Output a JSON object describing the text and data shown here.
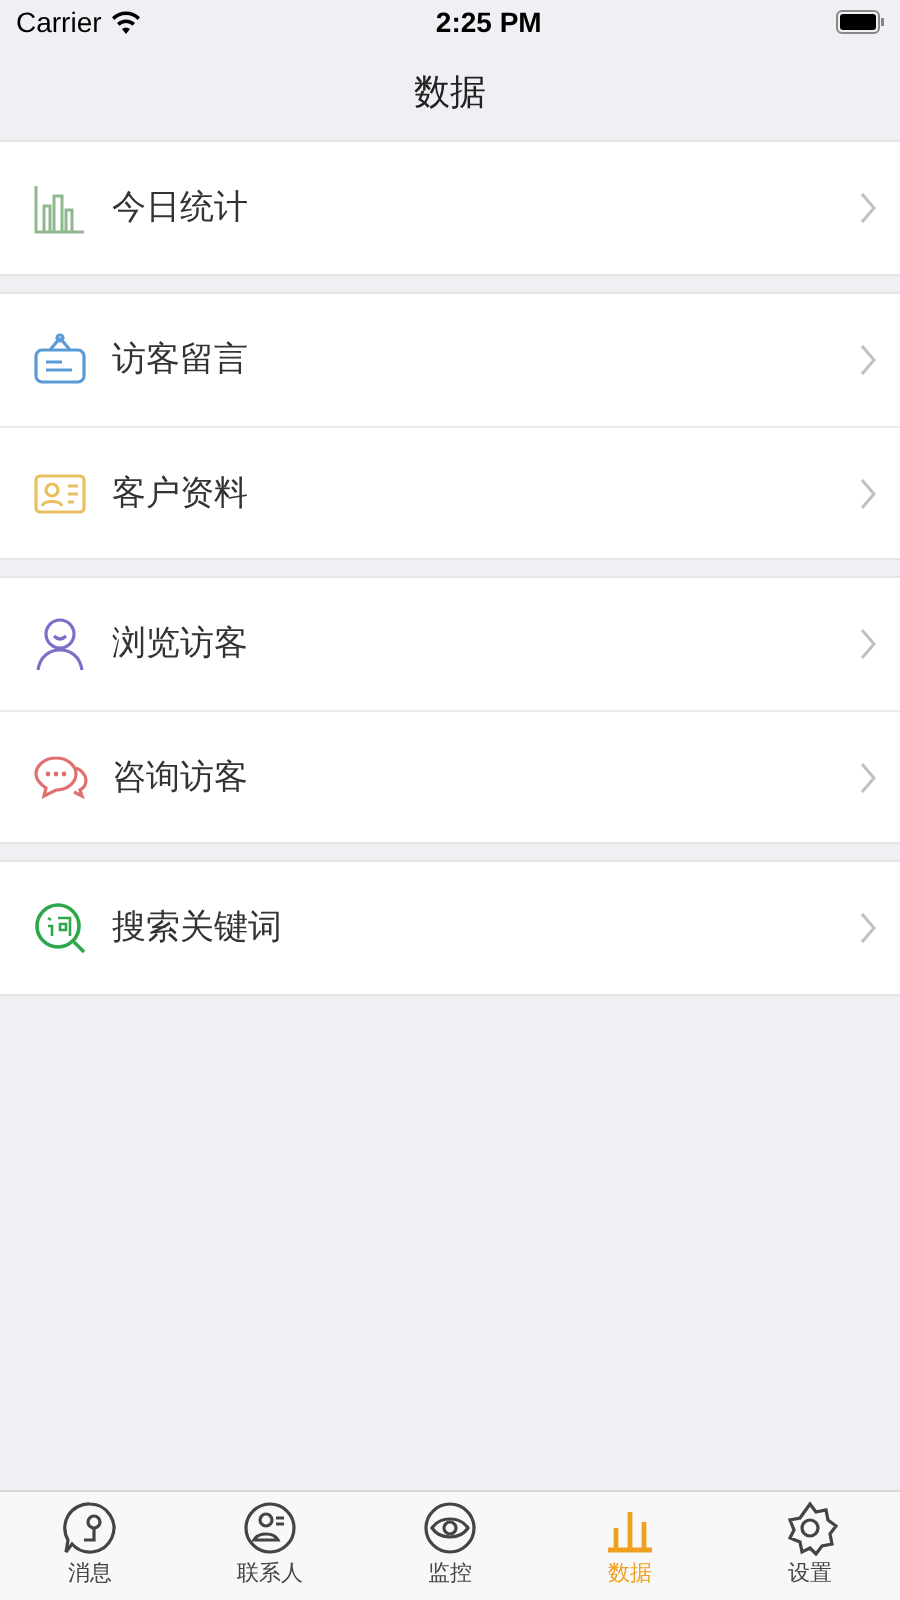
{
  "status_bar": {
    "carrier": "Carrier",
    "time": "2:25 PM"
  },
  "nav_bar": {
    "title": "数据"
  },
  "groups": [
    {
      "rows": [
        {
          "kind": "chart",
          "label": "今日统计"
        }
      ]
    },
    {
      "rows": [
        {
          "kind": "message",
          "label": "访客留言"
        },
        {
          "kind": "card",
          "label": "客户资料"
        }
      ]
    },
    {
      "rows": [
        {
          "kind": "person",
          "label": "浏览访客"
        },
        {
          "kind": "chat",
          "label": "咨询访客"
        }
      ]
    },
    {
      "rows": [
        {
          "kind": "keyword",
          "label": "搜索关键词"
        }
      ]
    }
  ],
  "tab_bar": [
    {
      "kind": "message",
      "label": "消息",
      "selected": false
    },
    {
      "kind": "contacts",
      "label": "联系人",
      "selected": false
    },
    {
      "kind": "eye",
      "label": "监控",
      "selected": false
    },
    {
      "kind": "data",
      "label": "数据",
      "selected": true
    },
    {
      "kind": "settings",
      "label": "设置",
      "selected": false
    }
  ]
}
